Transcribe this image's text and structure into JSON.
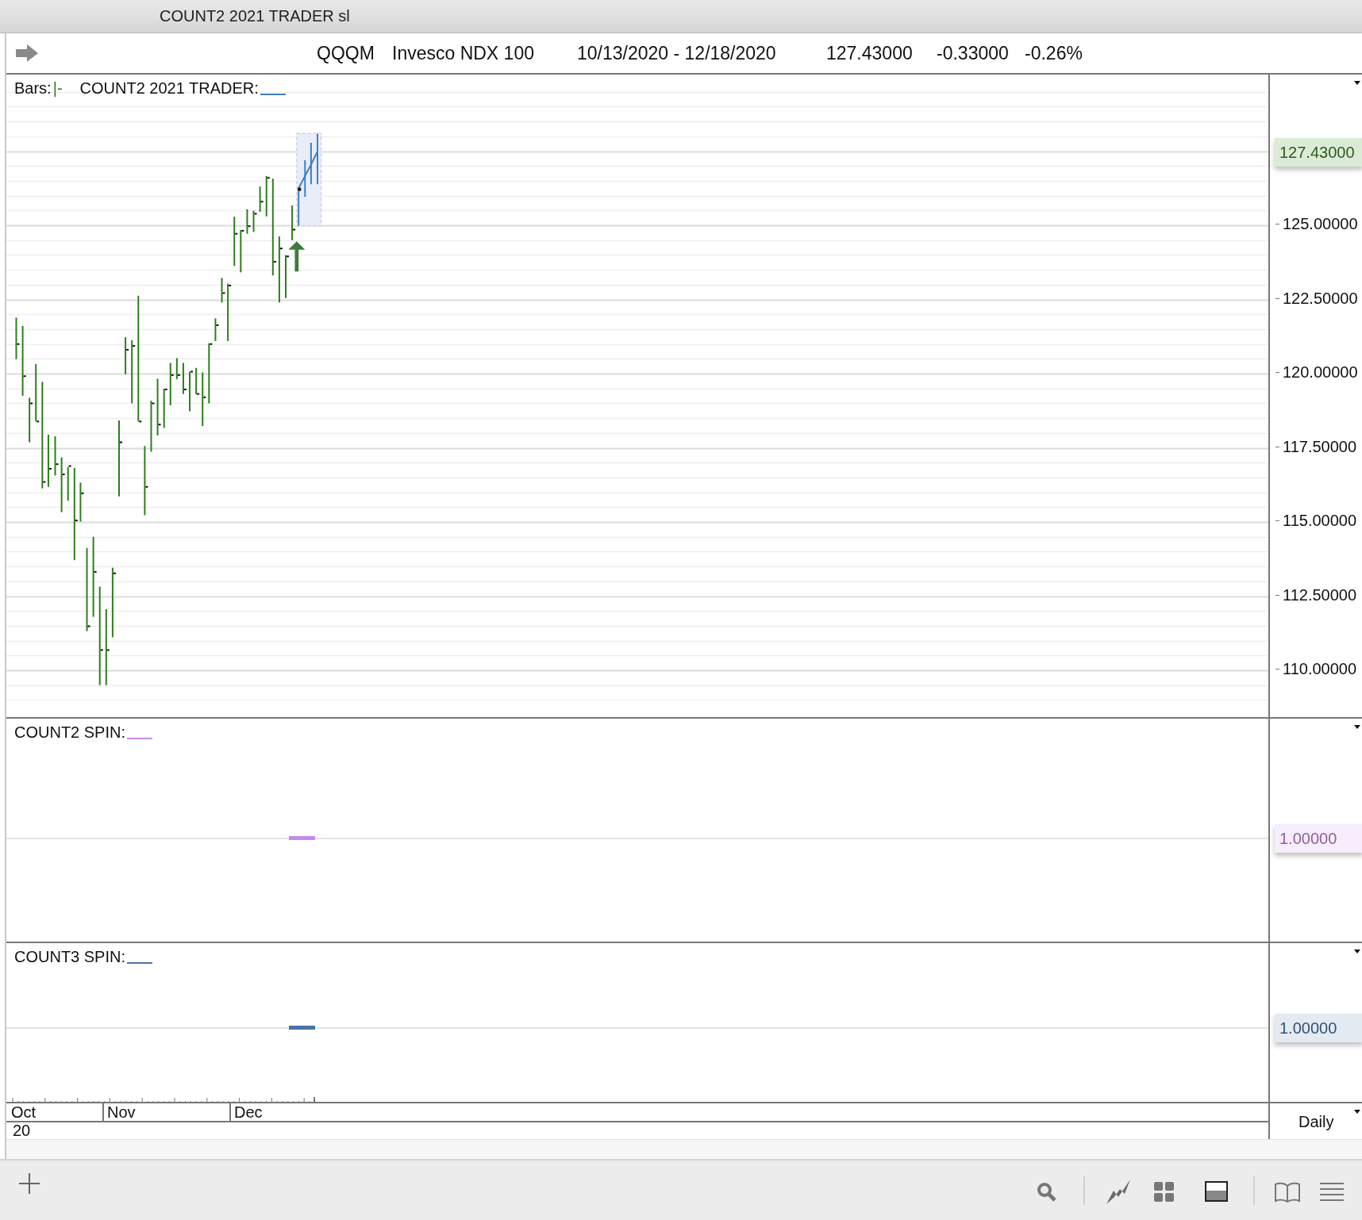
{
  "window": {
    "title": "COUNT2 2021 TRADER sl"
  },
  "header": {
    "symbol": "QQQM",
    "name": "Invesco NDX 100",
    "date_range": "10/13/2020 - 12/18/2020",
    "last": "127.43000",
    "change": "-0.33000",
    "change_percent": "-0.26%"
  },
  "panels": [
    {
      "kind": "price",
      "bars_label": "Bars:",
      "bars_sample": "|-",
      "study_label": "COUNT2 2021 TRADER:",
      "color": "#3d7fc0",
      "marker_value": "127.43000",
      "axis_labels": [
        "125.00000",
        "122.50000",
        "120.00000",
        "117.50000",
        "115.00000",
        "112.50000",
        "110.00000"
      ]
    },
    {
      "kind": "study",
      "study_label": "COUNT2 SPIN:",
      "color": "#c98ae8",
      "marker_value": "1.00000"
    },
    {
      "kind": "study",
      "study_label": "COUNT3 SPIN:",
      "color": "#4a74a8",
      "marker_value": "1.00000"
    }
  ],
  "time_axis": {
    "months": [
      "Oct",
      "Nov",
      "Dec"
    ],
    "year": "20",
    "interval": "Daily"
  }
}
